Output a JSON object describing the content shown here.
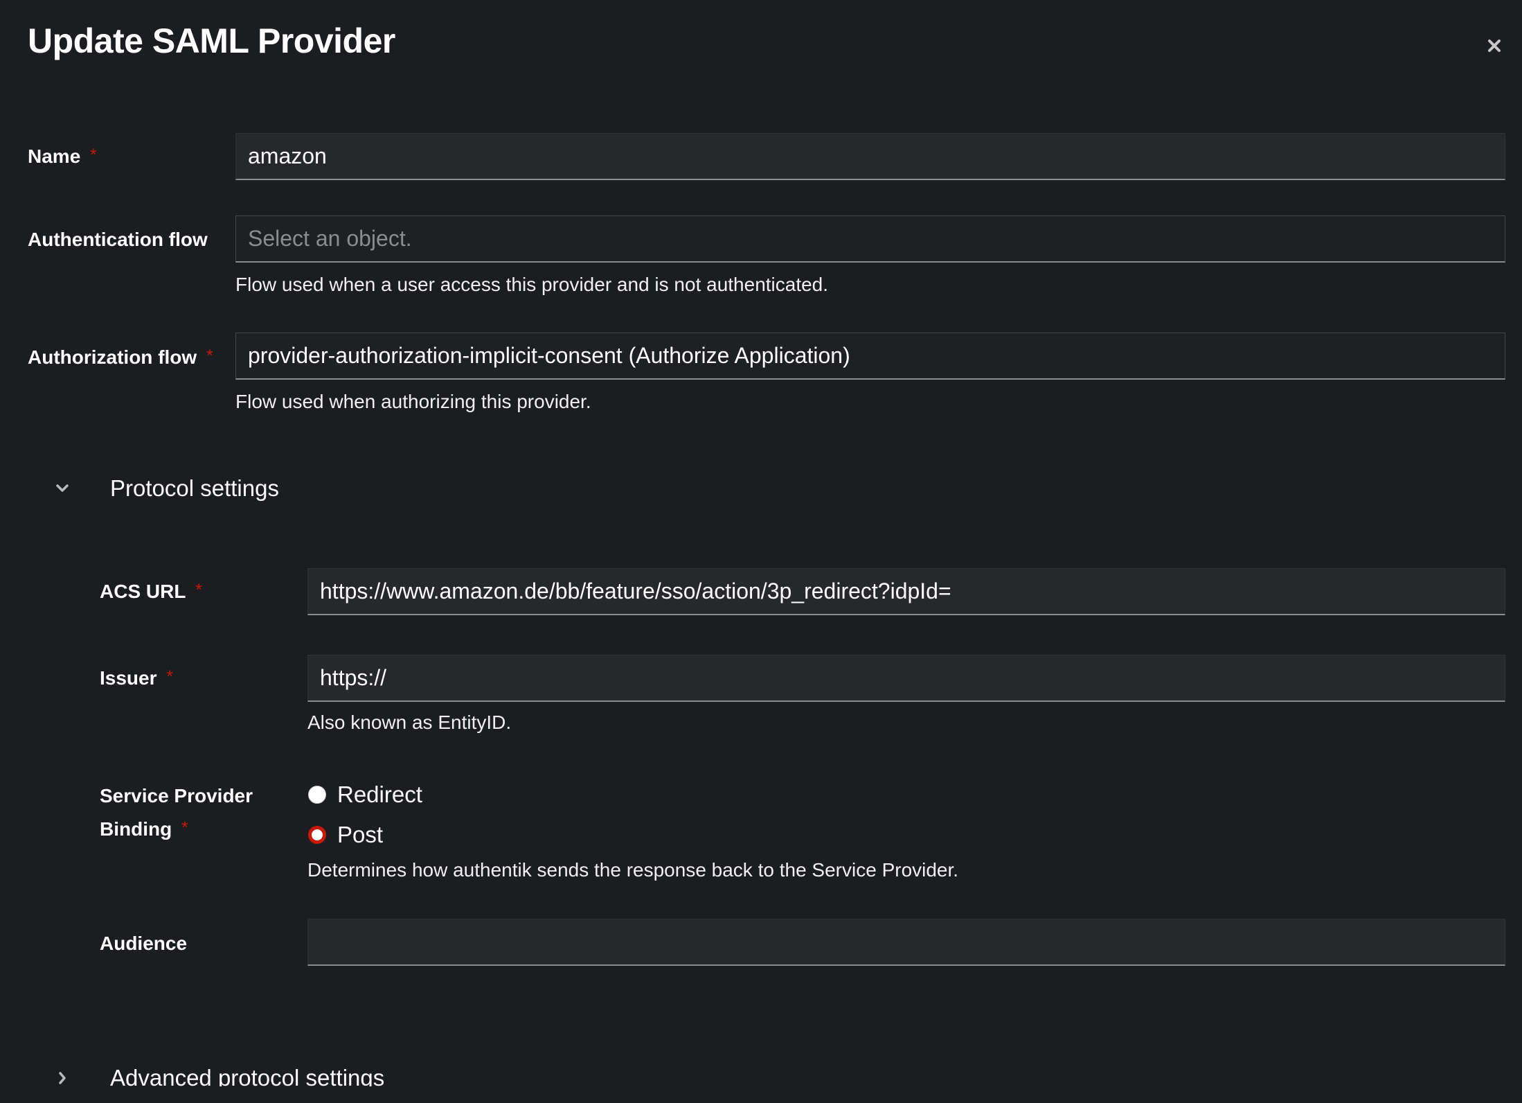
{
  "modal": {
    "title": "Update SAML Provider"
  },
  "form": {
    "name": {
      "label": "Name",
      "value": "amazon"
    },
    "authentication_flow": {
      "label": "Authentication flow",
      "placeholder": "Select an object.",
      "helper": "Flow used when a user access this provider and is not authenticated."
    },
    "authorization_flow": {
      "label": "Authorization flow",
      "value": "provider-authorization-implicit-consent (Authorize Application)",
      "helper": "Flow used when authorizing this provider."
    },
    "protocol_settings": {
      "title": "Protocol settings",
      "expanded": true,
      "acs_url": {
        "label": "ACS URL",
        "value": "https://www.amazon.de/bb/feature/sso/action/3p_redirect?idpId="
      },
      "issuer": {
        "label": "Issuer",
        "value": "https://",
        "helper": "Also known as EntityID."
      },
      "binding": {
        "label_line1": "Service Provider",
        "label_line2": "Binding",
        "options": [
          {
            "label": "Redirect",
            "selected": false
          },
          {
            "label": "Post",
            "selected": true
          }
        ],
        "helper": "Determines how authentik sends the response back to the Service Provider."
      },
      "audience": {
        "label": "Audience",
        "value": ""
      }
    },
    "advanced_protocol_settings": {
      "title": "Advanced protocol settings",
      "expanded": false
    },
    "required_marker": "*"
  },
  "icons": {
    "close": "close-icon",
    "expanded": "chevron-down-icon",
    "collapsed": "chevron-right-icon"
  },
  "colors": {
    "background": "#1b1d21",
    "input_bg": "#26282c",
    "required": "#c9190b",
    "radio_selected": "#c9190b"
  }
}
